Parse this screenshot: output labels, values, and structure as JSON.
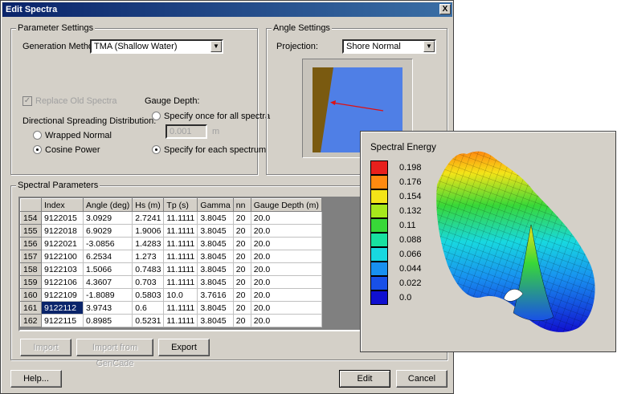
{
  "dialog": {
    "title": "Edit Spectra",
    "close_glyph": "X"
  },
  "parameter_settings": {
    "group_title": "Parameter Settings",
    "generation_method_label": "Generation Method",
    "generation_method_value": "TMA (Shallow Water)",
    "replace_old_spectra_label": "Replace Old Spectra",
    "replace_old_spectra_checked": true,
    "directional_spreading_label": "Directional Spreading Distribution:",
    "wrapped_normal_label": "Wrapped Normal",
    "cosine_power_label": "Cosine Power",
    "spreading_selected": "Cosine Power",
    "gauge_depth_label": "Gauge Depth:",
    "specify_once_label": "Specify once for all spectra",
    "specify_once_value": "0.001",
    "specify_once_unit": "m",
    "specify_each_label": "Specify for each spectrum",
    "gauge_selected": "Specify for each spectrum"
  },
  "angle_settings": {
    "group_title": "Angle Settings",
    "projection_label": "Projection:",
    "projection_value": "Shore Normal",
    "colors": {
      "land": "#7a5a10",
      "water": "#4f7fe6",
      "arrow": "#e01010"
    }
  },
  "spectral_parameters": {
    "group_title": "Spectral Parameters",
    "columns": [
      "Index",
      "Angle (deg)",
      "Hs (m)",
      "Tp (s)",
      "Gamma",
      "nn",
      "Gauge Depth (m)"
    ],
    "rows": [
      {
        "row": "154",
        "cells": [
          "9122015",
          "3.0929",
          "2.7241",
          "11.1111",
          "3.8045",
          "20",
          "20.0"
        ]
      },
      {
        "row": "155",
        "cells": [
          "9122018",
          "6.9029",
          "1.9006",
          "11.1111",
          "3.8045",
          "20",
          "20.0"
        ]
      },
      {
        "row": "156",
        "cells": [
          "9122021",
          "-3.0856",
          "1.4283",
          "11.1111",
          "3.8045",
          "20",
          "20.0"
        ]
      },
      {
        "row": "157",
        "cells": [
          "9122100",
          "6.2534",
          "1.273",
          "11.1111",
          "3.8045",
          "20",
          "20.0"
        ]
      },
      {
        "row": "158",
        "cells": [
          "9122103",
          "1.5066",
          "0.7483",
          "11.1111",
          "3.8045",
          "20",
          "20.0"
        ]
      },
      {
        "row": "159",
        "cells": [
          "9122106",
          "4.3607",
          "0.703",
          "11.1111",
          "3.8045",
          "20",
          "20.0"
        ]
      },
      {
        "row": "160",
        "cells": [
          "9122109",
          "-1.8089",
          "0.5803",
          "10.0",
          "3.7616",
          "20",
          "20.0"
        ]
      },
      {
        "row": "161",
        "cells": [
          "9122112",
          "3.9743",
          "0.6",
          "11.1111",
          "3.8045",
          "20",
          "20.0"
        ]
      },
      {
        "row": "162",
        "cells": [
          "9122115",
          "0.8985",
          "0.5231",
          "11.1111",
          "3.8045",
          "20",
          "20.0"
        ]
      }
    ],
    "selected_row": "161",
    "import_label": "Import",
    "import_gencade_label": "Import from GenCade",
    "export_label": "Export"
  },
  "footer": {
    "help_label": "Help...",
    "edit_label": "Edit",
    "cancel_label": "Cancel"
  },
  "spectral_plot": {
    "title": "Spectral Energy",
    "legend": [
      {
        "label": "0.198",
        "color": "#e8201c"
      },
      {
        "label": "0.176",
        "color": "#ff8a10"
      },
      {
        "label": "0.154",
        "color": "#f4e418"
      },
      {
        "label": "0.132",
        "color": "#a6e81c"
      },
      {
        "label": "0.11",
        "color": "#38d838"
      },
      {
        "label": "0.088",
        "color": "#18e0a0"
      },
      {
        "label": "0.066",
        "color": "#18d8e0"
      },
      {
        "label": "0.044",
        "color": "#1890f0"
      },
      {
        "label": "0.022",
        "color": "#1850e8"
      },
      {
        "label": "0.0",
        "color": "#1010d0"
      }
    ]
  }
}
